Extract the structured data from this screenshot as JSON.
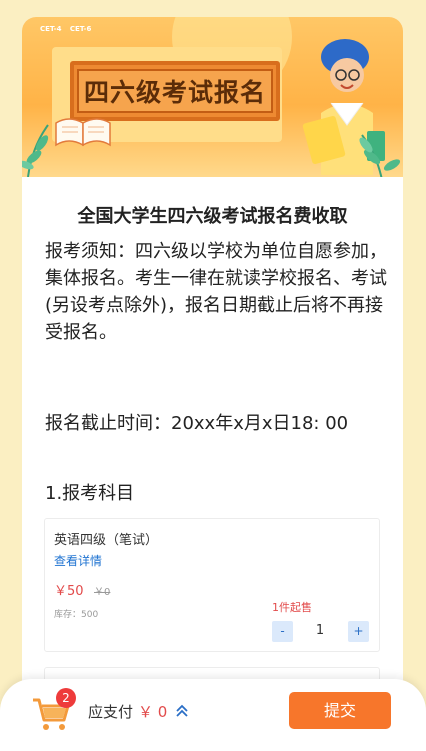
{
  "banner": {
    "tags": [
      "CET-4",
      "CET-6"
    ],
    "board_text": "四六级考试报名"
  },
  "title": "全国大学生四六级考试报名费收取",
  "notice": "报考须知：四六级以学校为单位自愿参加，集体报名。考生一律在就读学校报名、考试(另设考点除外)，报名日期截止后将不再接受报名。",
  "deadline": "报名截止时间：20xx年x月x日18: 00",
  "section_title": "1.报考科目",
  "product": {
    "name": "英语四级（笔试）",
    "detail_link": "查看详情",
    "price": "￥50",
    "original_price": "￥0",
    "stock": "库存：500",
    "min_purchase": "1件起售",
    "minus": "-",
    "plus": "+",
    "quantity": "1"
  },
  "bottom_bar": {
    "cart_count": "2",
    "pay_label": "应支付",
    "pay_amount": "￥ 0",
    "submit_label": "提交"
  },
  "colors": {
    "accent": "#f7762b",
    "price": "#e24b4b",
    "link": "#1f73d1",
    "background": "#fbefc2"
  }
}
